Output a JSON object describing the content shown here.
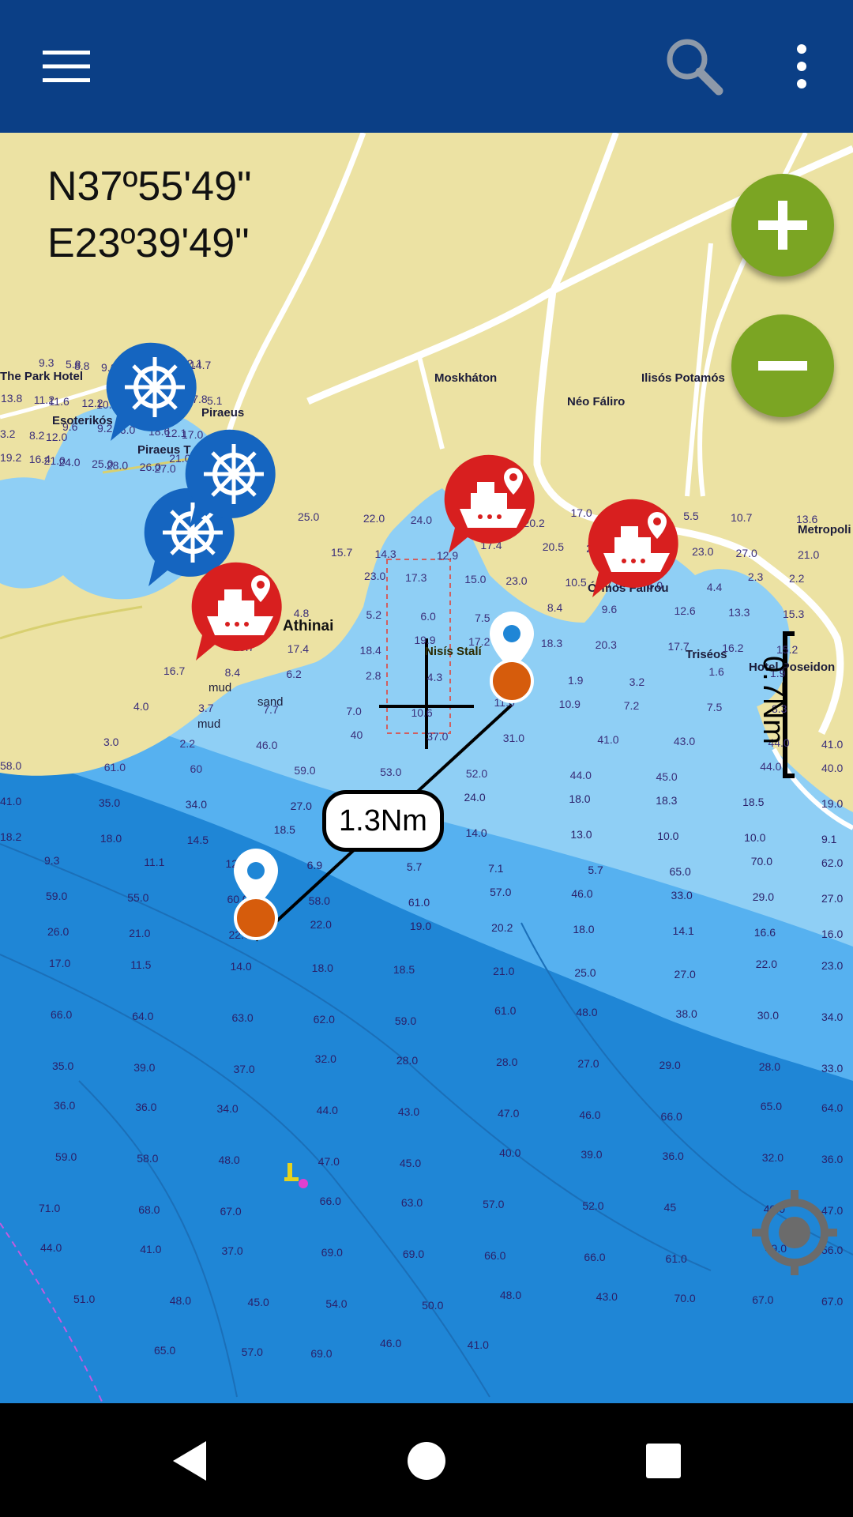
{
  "colors": {
    "topbar": "#0b3f86",
    "land": "#ece2a3",
    "shallow_water": "#8fcff5",
    "mid_water": "#56b1f0",
    "deep_water": "#1f86d6",
    "zoom_button": "#7ba523",
    "port_marker": "#d81f1f",
    "marina_marker": "#1565c0",
    "pin_orange": "#d65c0c"
  },
  "topbar": {
    "menu_icon": "hamburger-menu-icon",
    "search_icon": "search-icon",
    "more_icon": "more-vertical-icon"
  },
  "coordinates": {
    "lat": "N37º55'49\"",
    "lon": "E23º39'49\""
  },
  "zoom": {
    "in_icon": "plus-icon",
    "out_icon": "minus-icon"
  },
  "measure": {
    "distance": "1.3Nm"
  },
  "scale": {
    "label": "0.7Nm"
  },
  "places": [
    {
      "name": "The Park Hotel"
    },
    {
      "name": "Esoterikós"
    },
    {
      "name": "Piraeus"
    },
    {
      "name": "Piraeus T"
    },
    {
      "name": "Moskháton"
    },
    {
      "name": "Néo Fáliro"
    },
    {
      "name": "Ilisós Potamós"
    },
    {
      "name": "Metropoli"
    },
    {
      "name": "Athinai"
    },
    {
      "name": "Nisís Stalí"
    },
    {
      "name": "Órmos Fálirou"
    },
    {
      "name": "Hotel Poseidon"
    },
    {
      "name": "Triséos"
    },
    {
      "name": "mud"
    },
    {
      "name": "sand"
    },
    {
      "name": "mud"
    }
  ],
  "depths": [
    "9.3",
    "5.8",
    "8.8",
    "9.1",
    "11.0",
    "11.4",
    "14.0",
    "15.1",
    "12.1",
    "14.7",
    "13.8",
    "11.2",
    "11.6",
    "12.2",
    "10.2",
    "9.7",
    "5.8",
    "8.3",
    "7.8",
    "5.1",
    "3.2",
    "8.2",
    "12.0",
    "9.6",
    "9.2",
    "16.0",
    "18.6",
    "12.1",
    "17.0",
    "18.6",
    "19.2",
    "16.4",
    "21.0",
    "24.0",
    "25.0",
    "28.0",
    "26.0",
    "27.0",
    "21.0",
    "22.0",
    "25.0",
    "22.0",
    "24.0",
    "19.3",
    "20.2",
    "17.0",
    "21.0",
    "5.5",
    "10.7",
    "13.6",
    "15.7",
    "14.3",
    "12.9",
    "17.4",
    "20.5",
    "26.0",
    "25.0",
    "23.0",
    "27.0",
    "21.0",
    "23.0",
    "17.3",
    "15.0",
    "23.0",
    "10.5",
    "7.6",
    "6.0",
    "4.4",
    "2.3",
    "2.2",
    "3.6",
    "4.8",
    "5.2",
    "6.0",
    "7.5",
    "8.4",
    "9.6",
    "12.6",
    "13.3",
    "15.3",
    "15.7",
    "17.4",
    "18.4",
    "19.9",
    "17.2",
    "18.3",
    "20.3",
    "17.7",
    "16.2",
    "15.2",
    "16.7",
    "8.4",
    "6.2",
    "2.8",
    "4.3",
    "5.9",
    "1.9",
    "3.2",
    "1.6",
    "1.9",
    "4.0",
    "3.7",
    "7.7",
    "7.0",
    "10.6",
    "11.0",
    "10.9",
    "7.2",
    "7.5",
    "8.3",
    "3.0",
    "2.2",
    "46.0",
    "40",
    "37.0",
    "31.0",
    "41.0",
    "43.0",
    "44.0",
    "41.0",
    "58.0",
    "61.0",
    "60",
    "59.0",
    "53.0",
    "52.0",
    "44.0",
    "45.0",
    "44.0",
    "40.0",
    "41.0",
    "35.0",
    "34.0",
    "27.0",
    "28.0",
    "24.0",
    "18.0",
    "18.3",
    "18.5",
    "19.0",
    "18.2",
    "18.0",
    "14.5",
    "18.5",
    "14.9",
    "14.0",
    "13.0",
    "10.0",
    "10.0",
    "9.1",
    "9.3",
    "11.1",
    "12.8",
    "6.9",
    "5.7",
    "7.1",
    "5.7",
    "65.0",
    "70.0",
    "62.0",
    "59.0",
    "55.0",
    "60.0",
    "58.0",
    "61.0",
    "57.0",
    "46.0",
    "33.0",
    "29.0",
    "27.0",
    "26.0",
    "21.0",
    "22.0",
    "22.0",
    "19.0",
    "20.2",
    "18.0",
    "14.1",
    "16.6",
    "16.0",
    "17.0",
    "11.5",
    "14.0",
    "18.0",
    "18.5",
    "21.0",
    "25.0",
    "27.0",
    "22.0",
    "23.0",
    "66.0",
    "64.0",
    "63.0",
    "62.0",
    "59.0",
    "61.0",
    "48.0",
    "38.0",
    "30.0",
    "34.0",
    "35.0",
    "39.0",
    "37.0",
    "32.0",
    "28.0",
    "28.0",
    "27.0",
    "29.0",
    "28.0",
    "33.0",
    "36.0",
    "36.0",
    "34.0",
    "44.0",
    "43.0",
    "47.0",
    "46.0",
    "66.0",
    "65.0",
    "64.0",
    "59.0",
    "58.0",
    "48.0",
    "47.0",
    "45.0",
    "40.0",
    "39.0",
    "36.0",
    "32.0",
    "36.0",
    "71.0",
    "68.0",
    "67.0",
    "66.0",
    "63.0",
    "57.0",
    "52.0",
    "45",
    "49.0",
    "47.0",
    "44.0",
    "41.0",
    "37.0",
    "69.0",
    "69.0",
    "66.0",
    "66.0",
    "61.0",
    "49.0",
    "56.0",
    "51.0",
    "48.0",
    "45.0",
    "54.0",
    "50.0",
    "48.0",
    "43.0",
    "70.0",
    "67.0",
    "67.0",
    "65.0",
    "57.0",
    "69.0",
    "46.0",
    "41.0"
  ],
  "bottom_nav": {
    "back_icon": "back-triangle-icon",
    "home_icon": "home-circle-icon",
    "recents_icon": "recents-square-icon"
  }
}
